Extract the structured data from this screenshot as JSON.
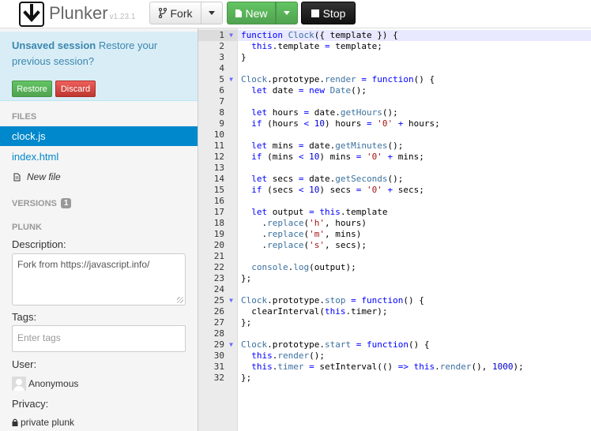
{
  "header": {
    "brand": "Plunker",
    "version": "v1.23.1",
    "fork_label": "Fork",
    "new_label": "New",
    "stop_label": "Stop"
  },
  "session": {
    "title": "Unsaved session",
    "message": "Restore your previous session?",
    "restore_label": "Restore",
    "discard_label": "Discard"
  },
  "files": {
    "heading": "FILES",
    "items": [
      "clock.js",
      "index.html"
    ],
    "active": "clock.js",
    "new_file_label": "New file"
  },
  "versions": {
    "heading": "VERSIONS",
    "count": "1"
  },
  "plunk": {
    "heading": "PLUNK",
    "description_label": "Description:",
    "description_value": "Fork from https://javascript.info/",
    "tags_label": "Tags:",
    "tags_placeholder": "Enter tags",
    "user_label": "User:",
    "user_name": "Anonymous",
    "privacy_label": "Privacy:",
    "privacy_value": "private plunk"
  },
  "editor": {
    "active_line": 1,
    "lines": [
      "function Clock({ template }) {",
      "  this.template = template;",
      "}",
      "",
      "Clock.prototype.render = function() {",
      "  let date = new Date();",
      "",
      "  let hours = date.getHours();",
      "  if (hours < 10) hours = '0' + hours;",
      "",
      "  let mins = date.getMinutes();",
      "  if (mins < 10) mins = '0' + mins;",
      "",
      "  let secs = date.getSeconds();",
      "  if (secs < 10) secs = '0' + secs;",
      "",
      "  let output = this.template",
      "    .replace('h', hours)",
      "    .replace('m', mins)",
      "    .replace('s', secs);",
      "",
      "  console.log(output);",
      "};",
      "",
      "Clock.prototype.stop = function() {",
      "  clearInterval(this.timer);",
      "};",
      "",
      "Clock.prototype.start = function() {",
      "  this.render();",
      "  this.timer = setInterval(() => this.render(), 1000);",
      "};"
    ],
    "fold_lines": [
      1,
      5,
      25,
      29
    ]
  }
}
